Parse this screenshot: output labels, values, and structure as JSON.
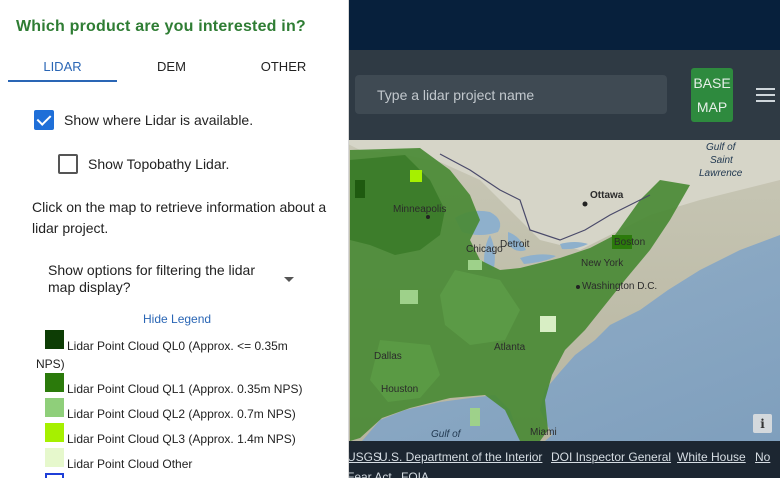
{
  "header": {
    "search_placeholder": "Type a lidar project name",
    "basemap_line1": "BASE",
    "basemap_line2": "MAP",
    "menu_icon": "hamburger-menu-icon"
  },
  "panel": {
    "title": "Which product are you interested in?",
    "tabs": [
      {
        "label": "LIDAR",
        "active": true
      },
      {
        "label": "DEM",
        "active": false
      },
      {
        "label": "OTHER",
        "active": false
      }
    ],
    "show_lidar": {
      "label": "Show where Lidar is available.",
      "checked": true
    },
    "show_topobathy": {
      "label": "Show Topobathy Lidar.",
      "checked": false
    },
    "instructions": "Click on the map to retrieve information about a lidar project.",
    "filter_options": "Show options for filtering the lidar map display?",
    "hide_legend": "Hide Legend",
    "legend": [
      {
        "line1": "Lidar Point Cloud QL0 (Approx. <= 0.35m",
        "line2": "NPS)",
        "color": "#0d3d05"
      },
      {
        "line1": "Lidar Point Cloud QL1 (Approx. 0.35m NPS)",
        "color": "#2b7a0b"
      },
      {
        "line1": "Lidar Point Cloud QL2 (Approx. 0.7m NPS)",
        "color": "#8fcf7a"
      },
      {
        "line1": "Lidar Point Cloud QL3 (Approx. 1.4m NPS)",
        "color": "#a6f000"
      },
      {
        "line1": "Lidar Point Cloud Other",
        "color": "#e6f8cc"
      }
    ]
  },
  "map": {
    "labels": {
      "gulf_st_lawrence_1": "Gulf of",
      "gulf_st_lawrence_2": "Saint",
      "gulf_st_lawrence_3": "Lawrence",
      "ottawa": "Ottawa",
      "minneapolis": "Minneapolis",
      "detroit": "Detroit",
      "chicago": "Chicago",
      "boston": "Boston",
      "new_york": "New York",
      "washington": "Washington D.C.",
      "dallas": "Dallas",
      "atlanta": "Atlanta",
      "houston": "Houston",
      "gulf_of": "Gulf of",
      "miami": "Miami"
    },
    "info": "i"
  },
  "footer": {
    "links": [
      "USGS",
      "U.S. Department of the Interior",
      "DOI Inspector General",
      "White House",
      "No",
      "Fear Act",
      "FOIA"
    ]
  }
}
